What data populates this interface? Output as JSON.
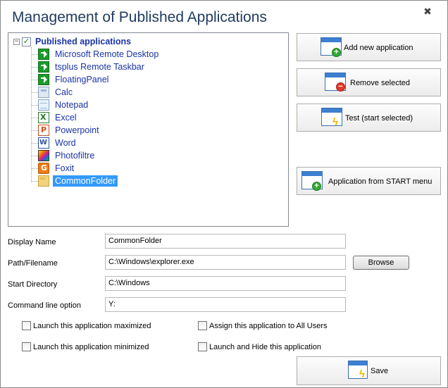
{
  "window": {
    "title": "Management of Published Applications",
    "close_label": "✖"
  },
  "tree": {
    "root_label": "Published applications",
    "expander": "−",
    "items": [
      {
        "label": "Microsoft Remote Desktop",
        "icon": "green-arrow-icon"
      },
      {
        "label": "tsplus Remote Taskbar",
        "icon": "green-arrow-icon"
      },
      {
        "label": "FloatingPanel",
        "icon": "green-arrow-icon"
      },
      {
        "label": "Calc",
        "icon": "calculator-icon"
      },
      {
        "label": "Notepad",
        "icon": "notepad-icon"
      },
      {
        "label": "Excel",
        "icon": "excel-icon"
      },
      {
        "label": "Powerpoint",
        "icon": "powerpoint-icon"
      },
      {
        "label": "Word",
        "icon": "word-icon"
      },
      {
        "label": "Photofiltre",
        "icon": "photofiltre-icon"
      },
      {
        "label": "Foxit",
        "icon": "foxit-icon"
      },
      {
        "label": "CommonFolder",
        "icon": "folder-icon",
        "selected": true
      }
    ]
  },
  "actions": {
    "add_new": "Add new application",
    "remove_selected": "Remove selected",
    "test": "Test (start selected)",
    "from_start_menu": "Application from START menu",
    "save": "Save"
  },
  "form": {
    "display_name_label": "Display Name",
    "display_name_value": "CommonFolder",
    "path_label": "Path/Filename",
    "path_value": "C:\\Windows\\explorer.exe",
    "browse_label": "Browse",
    "start_dir_label": "Start Directory",
    "start_dir_value": "C:\\Windows",
    "cmdline_label": "Command line option",
    "cmdline_value": "Y:"
  },
  "options": {
    "maximized": "Launch this application maximized",
    "minimized": "Launch this application minimized",
    "all_users": "Assign this application to All Users",
    "launch_hide": "Launch and Hide this application"
  },
  "colors": {
    "title": "#1e3a5c",
    "tree_text": "#1a33a8",
    "selection": "#3399ff"
  }
}
